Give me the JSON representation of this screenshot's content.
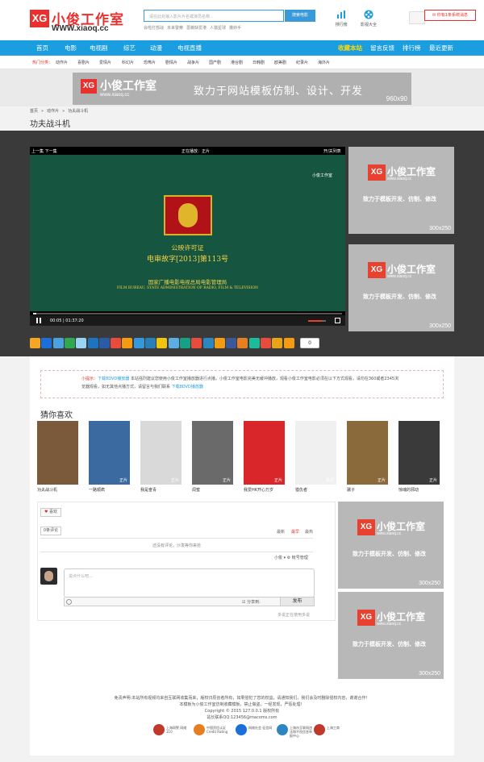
{
  "header": {
    "logo_mark": "XG",
    "logo_text": "小俊工作室",
    "logo_url": "WWW.xiaoq.cc",
    "search_placeholder": "请在此处输入影片片名或演员名称...",
    "search_button": "搜索电影",
    "hot_words": [
      "会啦打部战",
      "未来警察",
      "蔷薇缺爱港",
      "人猿星球",
      "撒娇手"
    ],
    "tool_rank": "排行榜",
    "tool_mobile": "影视大全",
    "notice": "你有1条系统消息"
  },
  "nav": {
    "items": [
      "首页",
      "电影",
      "电视剧",
      "综艺",
      "动漫",
      "电视直播"
    ],
    "right_items": [
      "收藏本站",
      "留言反馈",
      "排行榜",
      "最近更新"
    ]
  },
  "subnav": {
    "label": "热门分类：",
    "items": [
      "动作片",
      "喜剧片",
      "爱情片",
      "科幻片",
      "恐怖片",
      "剧情片",
      "战争片",
      "国产剧",
      "港台剧",
      "日韩剧",
      "欧美剧",
      "纪录片",
      "海外片"
    ]
  },
  "banner": {
    "mark": "XG",
    "title": "小俊工作室",
    "url": "www.xiaoq.cc",
    "slogan": "致力于网站模板仿制、设计、开发",
    "size": "960x90"
  },
  "breadcrumb": [
    "首页",
    "»",
    "动作片",
    "»",
    "功夫战斗机"
  ],
  "page_title": "功夫战斗机",
  "player": {
    "prev_next": "上一集 下一集",
    "now_playing": "正在播放：正片",
    "open_list": "开/关列表",
    "watermark": "小俊工作室",
    "license_line1": "公映许可证",
    "license_line2": "电审故字[2013]第113号",
    "license_line3": "国家广播电影电视总局电影管理局",
    "license_line4": "FILM BUREAU, STATE ADMINISTRATION OF RADIO, FILM & TELEVISION",
    "time": "00:05 | 01:37:20",
    "progress": 0.01,
    "volume": 0.75
  },
  "side_ad": {
    "mark": "XG",
    "title": "小俊工作室",
    "url": "www.xiaoq.cc",
    "slogan": "致力于模板开发、仿制、修改",
    "size": "300x250"
  },
  "share": {
    "count": "0",
    "colors": [
      "#f5a623",
      "#1b6fd8",
      "#4aa3df",
      "#2fa84f",
      "#9bd3f2",
      "#1e73be",
      "#2b5aa6",
      "#e94c3d",
      "#f39c12",
      "#3498db",
      "#2980b9",
      "#f1c40f",
      "#5dade2",
      "#16a085",
      "#e74c3c",
      "#2e86c1",
      "#f39c12",
      "#3b5998",
      "#e67e22",
      "#1abc9c",
      "#e74c3c",
      "#e8a317",
      "#f39c12"
    ]
  },
  "tip": {
    "label": "小提示：",
    "link": "下载8DVD播放器",
    "text": "本站强烈建议您使用小俊工作室播放器进行点播，小俊工作室电影完美无缓冲播放，观看小俊工作室电影必须在以下方式观看，请勿在360或者2345浏览器观看，如无其他点播方式，请留言与我们联系",
    "link2": "下载8DVD播放器"
  },
  "recommend": {
    "title": "猜你喜欢",
    "items": [
      {
        "name": "功夫战斗机",
        "tag": "",
        "color": "#7a5a3a"
      },
      {
        "name": "一路顺疯",
        "tag": "正片",
        "color": "#3a6aa0"
      },
      {
        "name": "我是奋青",
        "tag": "正片",
        "color": "#d9d9d9"
      },
      {
        "name": "闺蜜",
        "tag": "正片",
        "color": "#6a6a6a"
      },
      {
        "name": "我爱HK开心万岁",
        "tag": "正片",
        "color": "#d8262a"
      },
      {
        "name": "猎仇者",
        "tag": "高清",
        "color": "#f0f0f0"
      },
      {
        "name": "骡子",
        "tag": "正片",
        "color": "#8a6a3a"
      },
      {
        "name": "惊魂的邪动",
        "tag": "正片",
        "color": "#3a3a3a"
      }
    ]
  },
  "comments": {
    "like": "喜欢",
    "count": "0条评论",
    "sort": [
      "最新",
      "最早",
      "最热"
    ],
    "empty": "还没有评论，沙发等你来抢",
    "user": "小俊 ▾   ⚙ 帐号管理",
    "placeholder": "说点什么吧...",
    "sync": "☑ 分享到:",
    "submit": "发布",
    "powered": "多说正在使用多说"
  },
  "footer": {
    "lines": [
      "免责声明:本站所有视频均来自互联网收集而来，版权归原创者所有，如果侵犯了您的权益，请通知我们，我们会及时删除侵权内容，谢谢合作！",
      "本模板为小俊工作室仿制收藏模板，禁止做盗，一经发现，严惩处理！",
      "Copyright © 2015 127.0.0.1 版权所有",
      "站长联系QQ:123456@macoms.com"
    ],
    "badges": [
      {
        "label": "上海网警 网络110",
        "color": "#c0392b"
      },
      {
        "label": "中国资信认证 Credit Rating",
        "color": "#e67e22"
      },
      {
        "label": "网络社会 征信网",
        "color": "#1b6fd8"
      },
      {
        "label": "上海市互联网违法和不良信息举报中心",
        "color": "#2e86c1"
      },
      {
        "label": "上海工商",
        "color": "#c0392b"
      }
    ]
  }
}
